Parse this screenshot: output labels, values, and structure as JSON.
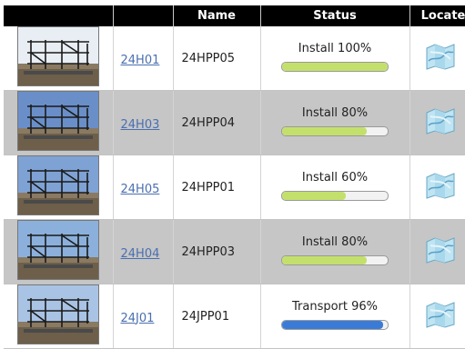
{
  "columns": {
    "photo": "",
    "id": "",
    "name": "Name",
    "status": "Status",
    "locate": "Locate"
  },
  "colors": {
    "install_bar": "#c4e06c",
    "transport_bar": "#3b7bd8",
    "link": "#4a6fb0",
    "header_bg": "#000000"
  },
  "rows": [
    {
      "id": "24H01",
      "name": "24HPP05",
      "status": "Install 100%",
      "progress": 1.0,
      "bar_color": "#c4e06c",
      "photo_icon": "steel-frame-photo",
      "locate_icon": "map-icon",
      "sky": "#e8eef4"
    },
    {
      "id": "24H03",
      "name": "24HPP04",
      "status": "Install 80%",
      "progress": 0.8,
      "bar_color": "#c4e06c",
      "photo_icon": "steel-frame-photo",
      "locate_icon": "map-icon",
      "sky": "#6a8fc8"
    },
    {
      "id": "24H05",
      "name": "24HPP01",
      "status": "Install 60%",
      "progress": 0.6,
      "bar_color": "#c4e06c",
      "photo_icon": "steel-frame-photo",
      "locate_icon": "map-icon",
      "sky": "#7fa2d4"
    },
    {
      "id": "24H04",
      "name": "24HPP03",
      "status": "Install 80%",
      "progress": 0.8,
      "bar_color": "#c4e06c",
      "photo_icon": "steel-frame-photo",
      "locate_icon": "map-icon",
      "sky": "#8cb0dc"
    },
    {
      "id": "24J01",
      "name": "24JPP01",
      "status": "Transport 96%",
      "progress": 0.96,
      "bar_color": "#3b7bd8",
      "photo_icon": "steel-frame-photo",
      "locate_icon": "map-icon",
      "sky": "#a9c3e4"
    }
  ]
}
